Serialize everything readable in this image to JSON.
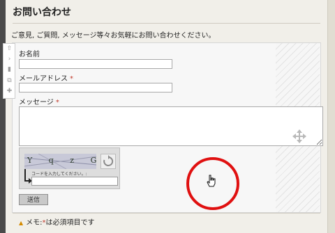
{
  "page": {
    "title": "お問い合わせ",
    "intro": "ご意見, ご質問, メッセージ等々お気軽にお問い合わせください。"
  },
  "form": {
    "name_label": "お名前",
    "email_label": "メールアドレス",
    "message_label": "メッセージ",
    "required_mark": "*",
    "name_value": "",
    "email_value": "",
    "message_value": ""
  },
  "captcha": {
    "image_text": "Y q z G c",
    "hint": "コードを入力してください。:",
    "value": ""
  },
  "submit_label": "送信",
  "note": {
    "prefix": "メモ:",
    "star": "*",
    "text": "は必須項目です"
  },
  "colors": {
    "required": "#c0392b",
    "highlight_ring": "#e01010",
    "warn_icon": "#d48a00"
  },
  "icons": [
    "arrow-up-icon",
    "arrow-right-icon",
    "trash-icon",
    "copy-icon",
    "plus-icon",
    "move-icon",
    "refresh-icon",
    "warning-icon",
    "hand-cursor-icon"
  ]
}
